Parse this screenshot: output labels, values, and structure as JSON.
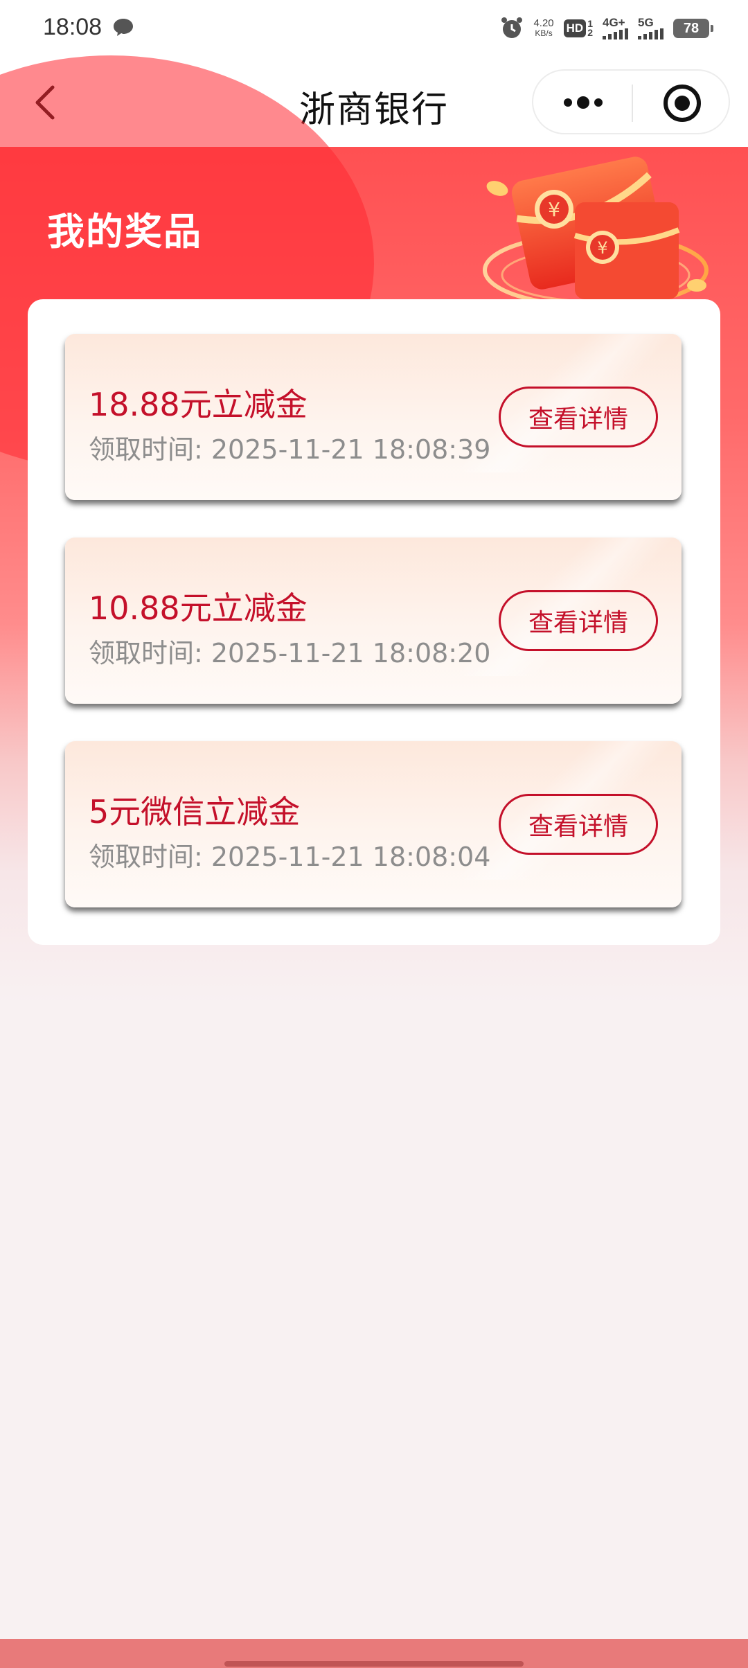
{
  "status_bar": {
    "time": "18:08",
    "net_speed": "4.20",
    "net_speed_unit": "KB/s",
    "hd_label": "HD",
    "hd_sub_top": "1",
    "hd_sub_bottom": "2",
    "signal_1_label": "4G+",
    "signal_2_label": "5G",
    "battery": "78"
  },
  "nav": {
    "title": "浙商银行"
  },
  "hero": {
    "title": "我的奖品"
  },
  "prizes": [
    {
      "name": "18.88元立减金",
      "time": "领取时间: 2025-11-21 18:08:39",
      "button": "查看详情"
    },
    {
      "name": "10.88元立减金",
      "time": "领取时间: 2025-11-21 18:08:20",
      "button": "查看详情"
    },
    {
      "name": "5元微信立减金",
      "time": "领取时间: 2025-11-21 18:08:04",
      "button": "查看详情"
    }
  ],
  "colors": {
    "primary_red": "#c4102a",
    "hero_red": "#ff5052"
  },
  "icons": {
    "back": "chevron-left-icon",
    "more": "more-dots-icon",
    "close": "target-circle-icon",
    "message": "chat-bubble-icon",
    "alarm": "alarm-icon"
  }
}
